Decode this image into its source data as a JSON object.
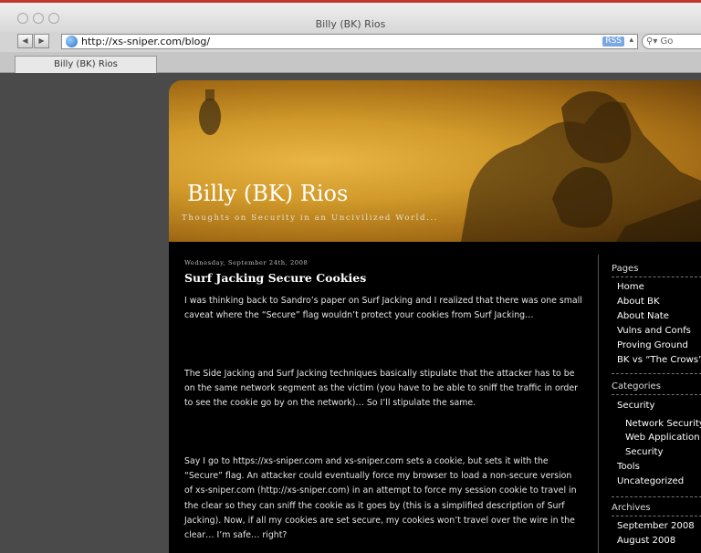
{
  "window": {
    "title": "Billy (BK) Rios"
  },
  "toolbar": {
    "url": "http://xs-sniper.com/blog/",
    "rss_label": "RSS",
    "search_placeholder": "Go"
  },
  "tabs": [
    {
      "label": "Billy (BK) Rios"
    }
  ],
  "blog": {
    "title": "Billy (BK) Rios",
    "tagline": "Thoughts on Security in an Uncivilized World..."
  },
  "post": {
    "date": "Wednesday, September 24th, 2008",
    "title": "Surf Jacking Secure Cookies",
    "paragraphs": [
      "I was thinking back to Sandro’s paper on Surf Jacking and I realized that there was one small caveat where the “Secure” flag wouldn’t protect your cookies from Surf Jacking…",
      "The Side Jacking and Surf Jacking techniques basically stipulate that the attacker has to be on the same network segment as the victim (you have to be able to sniff the traffic in order to see the cookie go by on the network)… So I’ll stipulate the same.",
      "Say I go to https://xs-sniper.com and xs-sniper.com sets a cookie, but sets it with the “Secure” flag. An attacker could eventually force my browser to load a non-secure version of xs-sniper.com (http://xs-sniper.com) in an attempt to force my session cookie to travel in the clear so they can sniff the cookie as it goes by (this is a simplified description of Surf Jacking). Now, if all my cookies are set secure, my cookies won’t travel over the wire in the clear… I’m safe… right?"
    ]
  },
  "sidebar": {
    "pages_heading": "Pages",
    "pages": [
      "Home",
      "About BK",
      "About Nate",
      "Vulns and Confs",
      "Proving Ground",
      "BK vs “The Crows”"
    ],
    "categories_heading": "Categories",
    "categories": [
      "Security",
      "Network Security",
      "Web Application",
      "Security",
      "Tools",
      "Uncategorized"
    ],
    "archives_heading": "Archives",
    "archives": [
      "September 2008",
      "August 2008"
    ]
  }
}
